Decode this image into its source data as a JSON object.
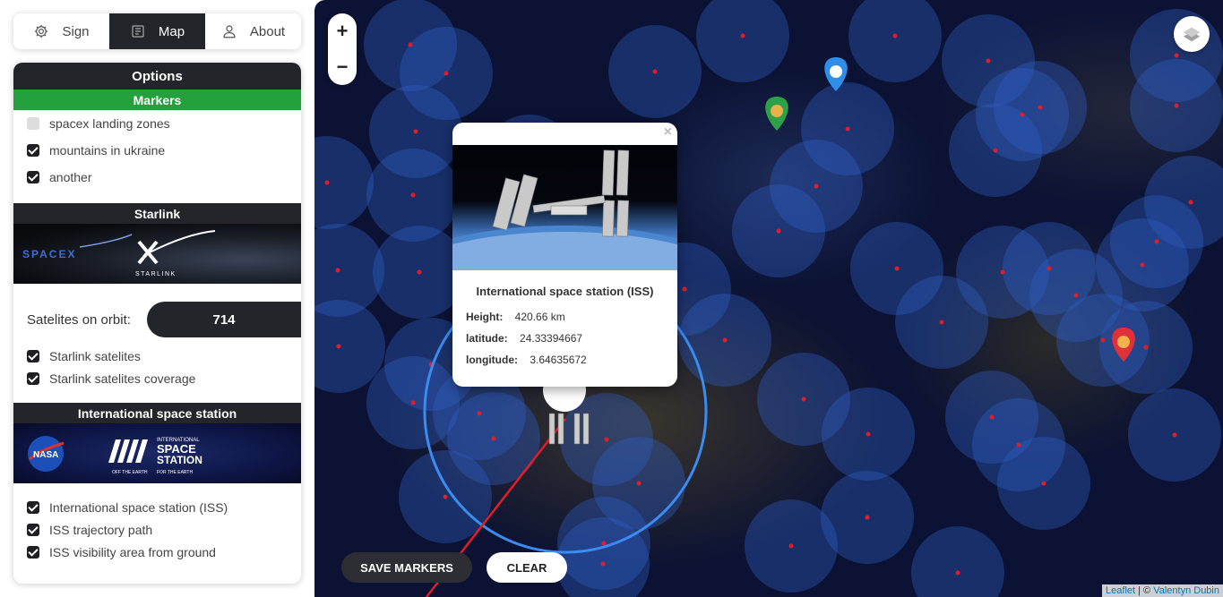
{
  "tabs": [
    {
      "label": "Sign",
      "icon": "gear-icon"
    },
    {
      "label": "Map",
      "icon": "map-icon"
    },
    {
      "label": "About",
      "icon": "user-icon"
    }
  ],
  "panel": {
    "title": "Options",
    "markers": {
      "title": "Markers",
      "items": [
        {
          "label": "spacex landing zones",
          "checked": false
        },
        {
          "label": "mountains in ukraine",
          "checked": true
        },
        {
          "label": "another",
          "checked": true
        }
      ]
    },
    "starlink": {
      "title": "Starlink",
      "banner_left": "SPACEX",
      "banner_right": "STARLINK",
      "orbit_label": "Satelites on orbit:",
      "orbit_count": "714",
      "items": [
        {
          "label": "Starlink satelites",
          "checked": true
        },
        {
          "label": "Starlink satelites coverage",
          "checked": true
        }
      ]
    },
    "iss": {
      "title": "International space station",
      "banner_logo": "NASA",
      "banner_line1": "INTERNATIONAL",
      "banner_line2": "SPACE",
      "banner_line3": "STATION",
      "banner_tag1": "OFF THE EARTH",
      "banner_tag2": "FOR THE EARTH",
      "items": [
        {
          "label": "International space station (ISS)",
          "checked": true
        },
        {
          "label": "ISS trajectory path",
          "checked": true
        },
        {
          "label": "ISS visibility area from ground",
          "checked": true
        }
      ]
    }
  },
  "map": {
    "zoom_in": "+",
    "zoom_out": "−",
    "layers_icon": "layers-icon",
    "popup": {
      "close": "×",
      "title": "International space station (ISS)",
      "height_label": "Height:",
      "height_value": "420.66 km",
      "lat_label": "latitude:",
      "lat_value": "24.33394667",
      "lon_label": "longitude:",
      "lon_value": "3.64635672"
    },
    "save_button": "SAVE MARKERS",
    "clear_button": "CLEAR",
    "attribution_link1": "Leaflet",
    "attribution_sep": " | © ",
    "attribution_link2": "Valentyn Dubin"
  },
  "colors": {
    "dark": "#23252b",
    "green": "#24a03d",
    "coverage": "#2f5ec4",
    "iss_ring": "#3b8cf0",
    "track": "#e01e2b"
  }
}
